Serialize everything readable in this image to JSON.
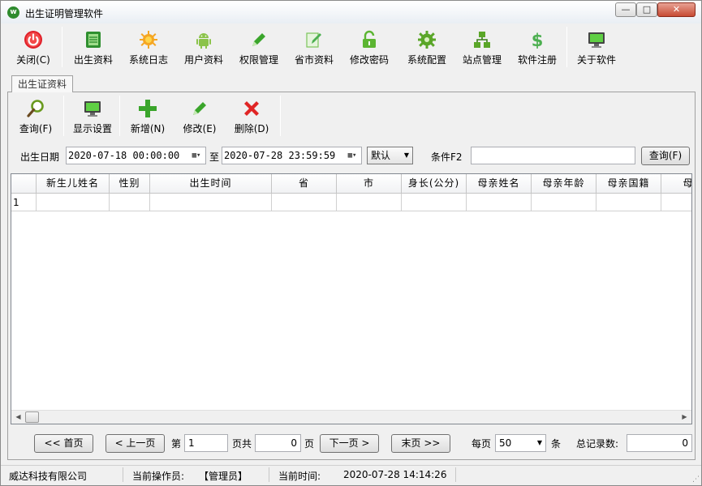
{
  "window": {
    "title": "出生证明管理软件",
    "minimize": "—",
    "maximize": "□",
    "close": "✕"
  },
  "main_toolbar": [
    {
      "id": "close",
      "label": "关闭(C)",
      "icon": "power-icon"
    },
    {
      "id": "birth",
      "label": "出生资料",
      "icon": "ledger-icon"
    },
    {
      "id": "syslog",
      "label": "系统日志",
      "icon": "sun-gear-icon"
    },
    {
      "id": "user",
      "label": "用户资料",
      "icon": "android-user-icon"
    },
    {
      "id": "perm",
      "label": "权限管理",
      "icon": "pencil-icon"
    },
    {
      "id": "city",
      "label": "省市资料",
      "icon": "edit-doc-icon"
    },
    {
      "id": "pwd",
      "label": "修改密码",
      "icon": "lock-icon"
    },
    {
      "id": "config",
      "label": "系统配置",
      "icon": "gear-icon"
    },
    {
      "id": "site",
      "label": "站点管理",
      "icon": "network-icon"
    },
    {
      "id": "reg",
      "label": "软件注册",
      "icon": "dollar-icon"
    },
    {
      "id": "about",
      "label": "关于软件",
      "icon": "monitor-icon"
    }
  ],
  "tab": {
    "label": "出生证资料"
  },
  "sub_toolbar": [
    {
      "id": "query",
      "label": "查询(F)",
      "icon": "search-icon"
    },
    {
      "id": "display",
      "label": "显示设置",
      "icon": "monitor-icon"
    },
    {
      "id": "add",
      "label": "新增(N)",
      "icon": "plus-icon"
    },
    {
      "id": "edit",
      "label": "修改(E)",
      "icon": "pencil-icon"
    },
    {
      "id": "delete",
      "label": "删除(D)",
      "icon": "delete-x-icon"
    }
  ],
  "filter": {
    "date_label": "出生日期",
    "date_from": "2020-07-18 00:00:00",
    "to_label": "至",
    "date_to": "2020-07-28 23:59:59",
    "mode_value": "默认",
    "condition_label": "条件F2",
    "condition_value": "",
    "query_button": "查询(F)"
  },
  "grid": {
    "columns": [
      "新生儿姓名",
      "性别",
      "出生时间",
      "省",
      "市",
      "身长(公分)",
      "母亲姓名",
      "母亲年龄",
      "母亲国籍",
      "母亲"
    ],
    "rows": [
      {
        "num": "1",
        "cells": [
          "",
          "",
          "",
          "",
          "",
          "",
          "",
          "",
          "",
          ""
        ]
      }
    ]
  },
  "pager": {
    "first": "<< 首页",
    "prev": "< 上一页",
    "page_label": "第",
    "page_value": "1",
    "page_total_label": "页共",
    "page_total_value": "0",
    "page_unit": "页",
    "next": "下一页 >",
    "last": "末页 >>",
    "per_page_label": "每页",
    "per_page_value": "50",
    "per_page_unit": "条",
    "total_label": "总记录数:",
    "total_value": "0"
  },
  "status": {
    "company": "威达科技有限公司",
    "operator_label": "当前操作员:",
    "operator_value": "【管理员】",
    "time_label": "当前时间:",
    "time_value": "2020-07-28 14:14:26"
  },
  "colors": {
    "power": "#e0202a",
    "green": "#3aa52b",
    "red_x": "#e02525"
  }
}
